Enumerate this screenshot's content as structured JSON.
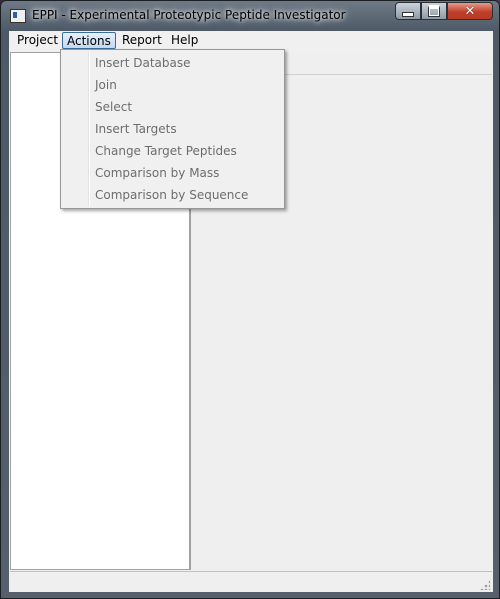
{
  "window": {
    "title": "EPPI - Experimental Proteotypic Peptide Investigator",
    "caption_buttons": {
      "minimize": "minimize-icon",
      "maximize": "maximize-icon",
      "close": "✕"
    }
  },
  "menubar": {
    "items": [
      {
        "label": "Project"
      },
      {
        "label": "Actions",
        "active": true
      },
      {
        "label": "Report"
      },
      {
        "label": "Help"
      }
    ]
  },
  "actions_menu": {
    "items": [
      {
        "label": "Insert Database",
        "enabled": false
      },
      {
        "label": "Join",
        "enabled": false
      },
      {
        "label": "Select",
        "enabled": false
      },
      {
        "label": "Insert Targets",
        "enabled": false
      },
      {
        "label": "Change Target Peptides",
        "enabled": false
      },
      {
        "label": "Comparison by Mass",
        "enabled": false
      },
      {
        "label": "Comparison by Sequence",
        "enabled": false
      }
    ]
  }
}
